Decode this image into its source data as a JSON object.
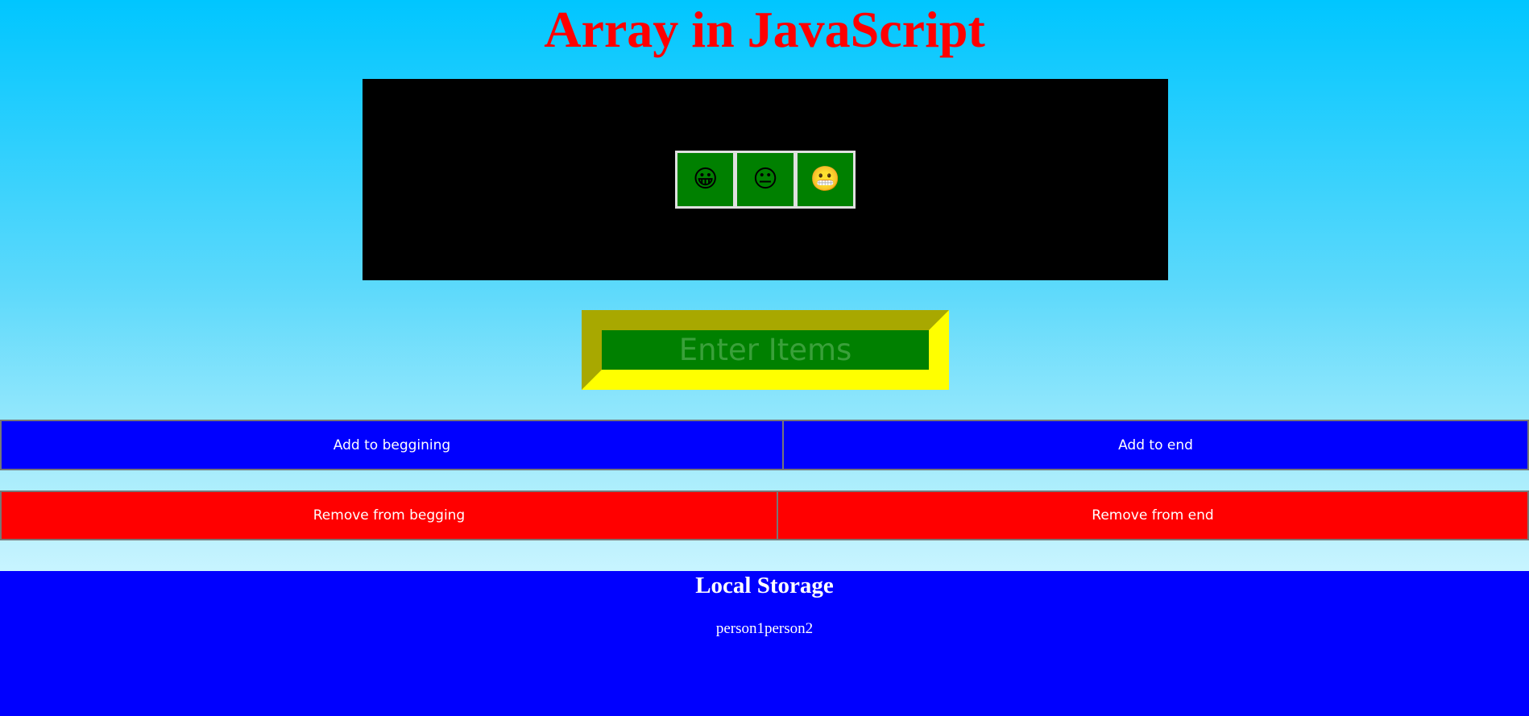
{
  "page": {
    "title": "Array in JavaScript"
  },
  "array_display": {
    "items": [
      "😀",
      "😐",
      "😬"
    ]
  },
  "input": {
    "placeholder": "Enter Items",
    "value": ""
  },
  "buttons": {
    "add_beginning": "Add to beggining",
    "add_end": "Add to end",
    "remove_beginning": "Remove from begging",
    "remove_end": "Remove from end"
  },
  "local_storage": {
    "title": "Local Storage",
    "content": "person1person2"
  },
  "colors": {
    "title": "#ff0000",
    "display_background": "#000000",
    "cell_background": "#008000",
    "input_frame": "#ffff00",
    "add_buttons": "#0000ff",
    "remove_buttons": "#ff0000",
    "storage_background": "#0000ff"
  }
}
